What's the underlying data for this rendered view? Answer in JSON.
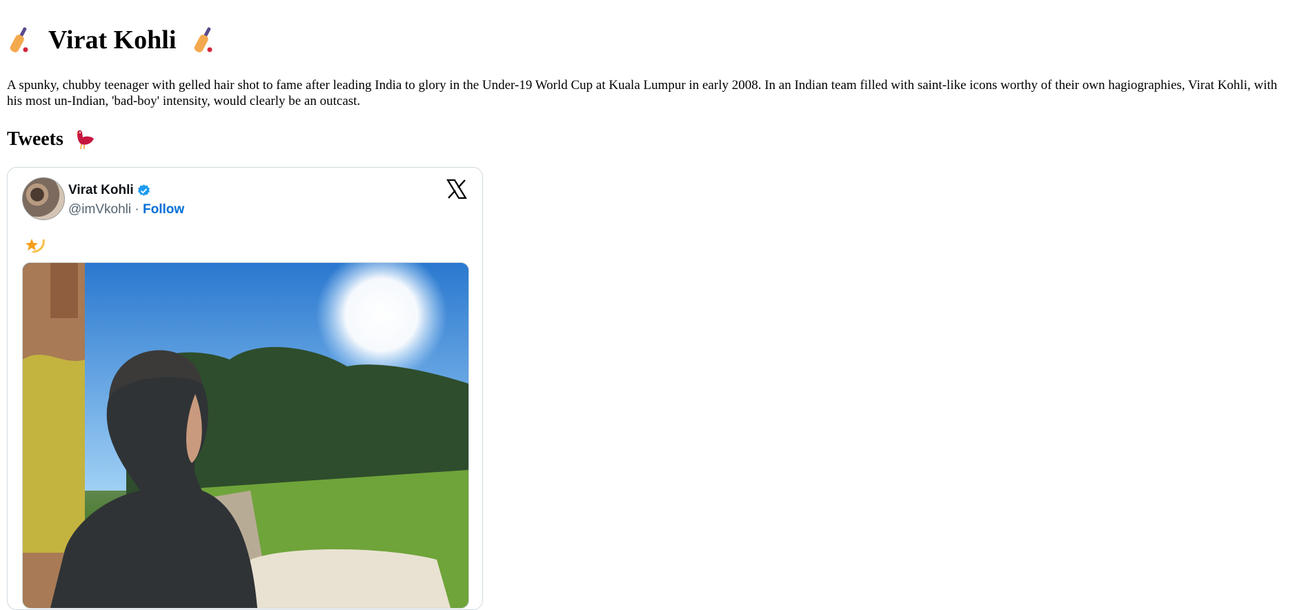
{
  "header": {
    "title": "Virat Kohli",
    "left_icon": "cricket-bat-icon",
    "right_icon": "cricket-bat-icon"
  },
  "intro": "A spunky, chubby teenager with gelled hair shot to fame after leading India to glory in the Under-19 World Cup at Kuala Lumpur in early 2008. In an Indian team filled with saint-like icons worthy of their own hagiographies, Virat Kohli, with his most un-Indian, 'bad-boy' intensity, would clearly be an outcast.",
  "tweets_section": {
    "heading": "Tweets",
    "heading_icon": "red-bird-icon"
  },
  "tweet": {
    "author_name": "Virat Kohli",
    "handle": "@imVkohli",
    "separator": "·",
    "follow_label": "Follow",
    "body_icon": "shooting-star-icon",
    "media_icon": "photo",
    "colors": {
      "follow": "#006fd6",
      "verified": "#1d9bf0",
      "border": "#cfd9de"
    }
  }
}
